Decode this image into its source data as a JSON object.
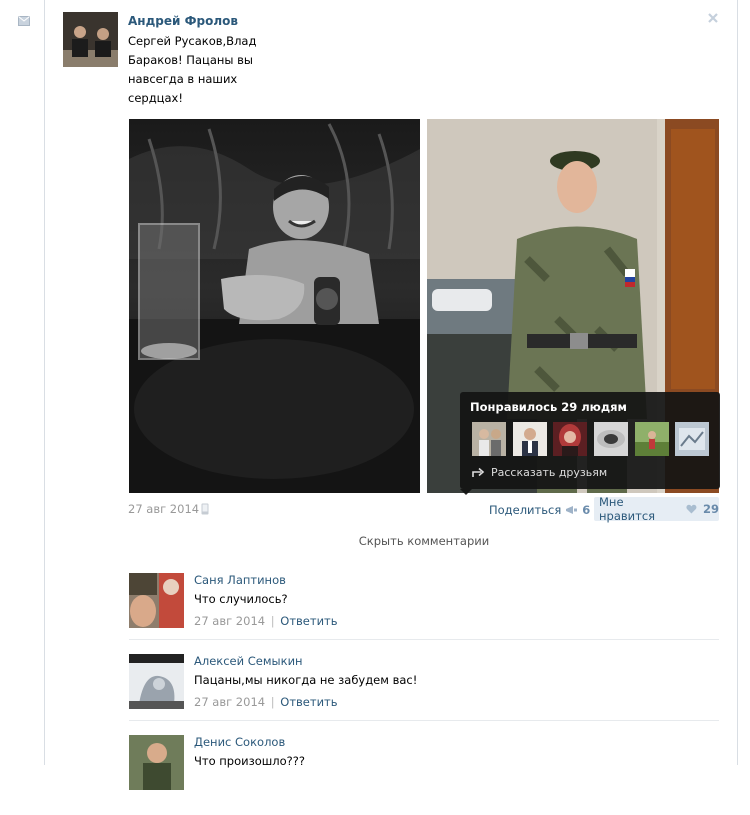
{
  "post": {
    "author": "Андрей Фролов",
    "text": "Сергей Русаков,Влад Бараков! Пацаны вы навсегда в наших сердцах!",
    "date": "27 авг 2014",
    "share_label": "Поделиться",
    "share_count": "6",
    "like_label": "Мне нравится",
    "like_count": "29",
    "hide_comments": "Скрыть комментарии"
  },
  "likes_popup": {
    "title": "Понравилось 29 людям",
    "share_label": "Рассказать друзьям"
  },
  "comments": [
    {
      "author": "Саня Лаптинов",
      "text": "Что случилось?",
      "date": "27 авг 2014",
      "reply": "Ответить"
    },
    {
      "author": "Алексей Семыкин",
      "text": "Пацаны,мы никогда не забудем вас!",
      "date": "27 авг 2014",
      "reply": "Ответить"
    },
    {
      "author": "Денис Соколов",
      "text": "Что произошло???",
      "date": "",
      "reply": ""
    }
  ],
  "colors": {
    "link": "#2b587a",
    "muted": "#999999",
    "like_bg": "#e6edf4"
  },
  "icons": [
    "mail-icon",
    "close-icon",
    "phone-icon",
    "megaphone-icon",
    "heart-icon",
    "share-arrow-icon"
  ]
}
